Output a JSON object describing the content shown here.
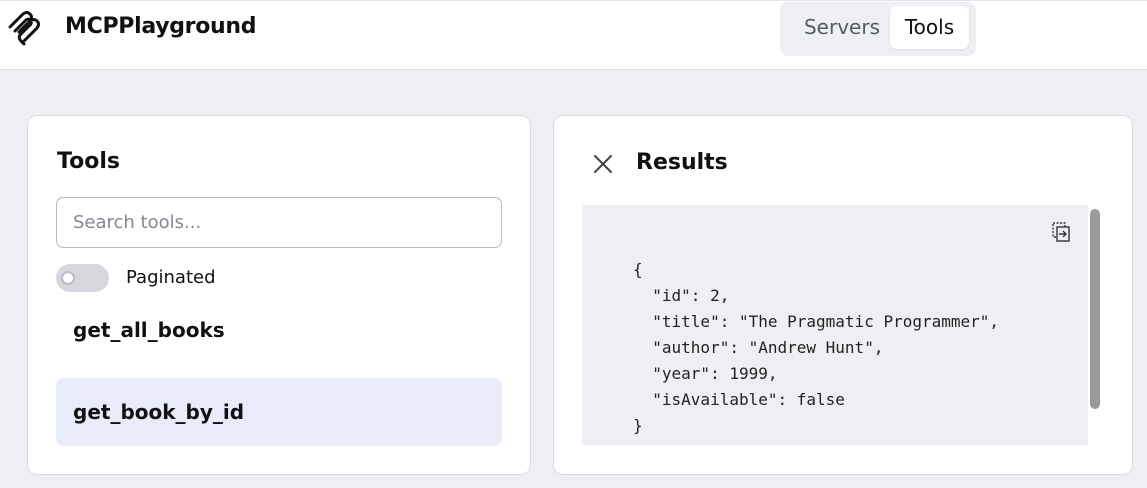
{
  "header": {
    "brand": "MCPPlayground",
    "tabs": [
      {
        "label": "Servers",
        "active": false
      },
      {
        "label": "Tools",
        "active": true
      }
    ]
  },
  "tools_panel": {
    "title": "Tools",
    "search_placeholder": "Search tools...",
    "search_value": "",
    "paginated_label": "Paginated",
    "paginated_on": false,
    "items": [
      {
        "label": "get_all_books",
        "selected": false
      },
      {
        "label": "get_book_by_id",
        "selected": true
      }
    ]
  },
  "results_panel": {
    "title": "Results",
    "code_lines": [
      "{",
      "  \"id\": 2,",
      "  \"title\": \"The Pragmatic Programmer\",",
      "  \"author\": \"Andrew Hunt\",",
      "  \"year\": 1999,",
      "  \"isAvailable\": false",
      "}"
    ]
  },
  "colors": {
    "accent_selected_bg": "#e8ebf9",
    "page_bg": "#eeeff3"
  }
}
